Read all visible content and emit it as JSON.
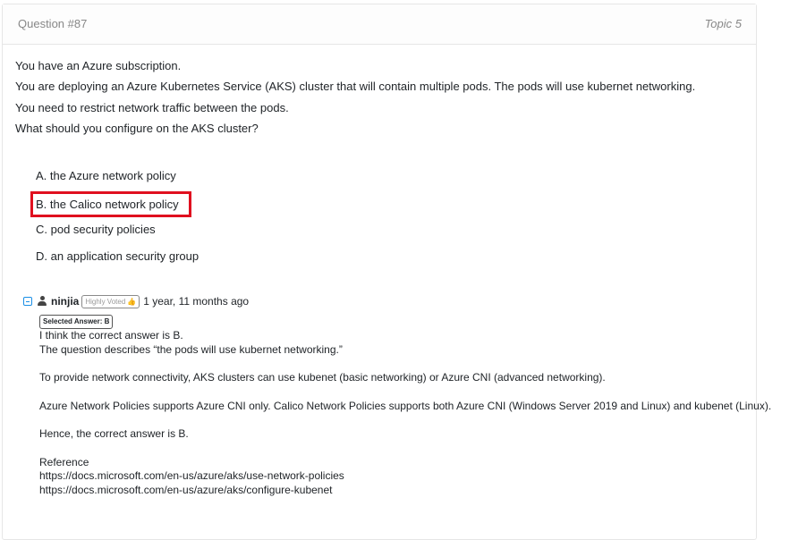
{
  "header": {
    "question_number": "Question #87",
    "topic": "Topic 5"
  },
  "question": {
    "lines": [
      "You have an Azure subscription.",
      "You are deploying an Azure Kubernetes Service (AKS) cluster that will contain multiple pods. The pods will use kubernet networking.",
      "You need to restrict network traffic between the pods.",
      "What should you configure on the AKS cluster?"
    ]
  },
  "choices": [
    {
      "label": "A. the Azure network policy",
      "correct": false
    },
    {
      "label": "B. the Calico network policy",
      "correct": true
    },
    {
      "label": "C. pod security policies",
      "correct": false
    },
    {
      "label": "D. an application security group",
      "correct": false
    }
  ],
  "comment": {
    "username": "ninjia",
    "badge": "Highly Voted",
    "date": "1 year, 11 months ago",
    "selected_answer": "Selected Answer: B",
    "text": {
      "l1": "I think the correct answer is B.",
      "l2": "The question describes “the pods will use kubernet networking.”",
      "p2": "To provide network connectivity, AKS clusters can use kubenet (basic networking) or Azure CNI (advanced networking).",
      "p3": "Azure Network Policies supports Azure CNI only. Calico Network Policies supports both Azure CNI (Windows Server 2019 and Linux) and kubenet (Linux).",
      "p4": "Hence, the correct answer is B.",
      "ref_label": "Reference",
      "ref1": "https://docs.microsoft.com/en-us/azure/aks/use-network-policies",
      "ref2": "https://docs.microsoft.com/en-us/azure/aks/configure-kubenet"
    }
  },
  "colors": {
    "correct_highlight": "#e0101f",
    "accent": "#1a8fe6"
  },
  "icons": {
    "collapse": "minus-square-icon",
    "user": "user-icon",
    "thumb": "thumbs-up-icon"
  }
}
